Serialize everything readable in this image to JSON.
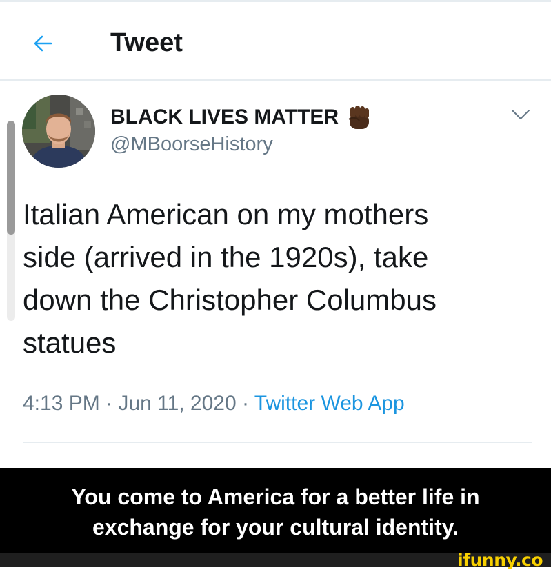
{
  "header": {
    "title": "Tweet",
    "back_icon": "arrow-left-icon"
  },
  "user": {
    "name": "BLACK LIVES MATTER",
    "handle": "@MBoorseHistory",
    "name_emoji": "raised-fist-icon"
  },
  "tweet": {
    "lines": [
      "Italian American on my mothers",
      "side (arrived in the 1920s), take",
      "down the Christopher Columbus",
      "statues"
    ],
    "time": "4:13 PM",
    "sep1": " · ",
    "date": "Jun 11, 2020",
    "sep2": " · ",
    "source": "Twitter Web App"
  },
  "caption": {
    "line1": "You come to America for a better life in",
    "line2": "exchange for your cultural identity."
  },
  "watermark": "ifunny.co",
  "colors": {
    "accent": "#1b95e0",
    "secondary_text": "#657786",
    "divider": "#e6ecf0",
    "watermark": "#f8d000"
  }
}
